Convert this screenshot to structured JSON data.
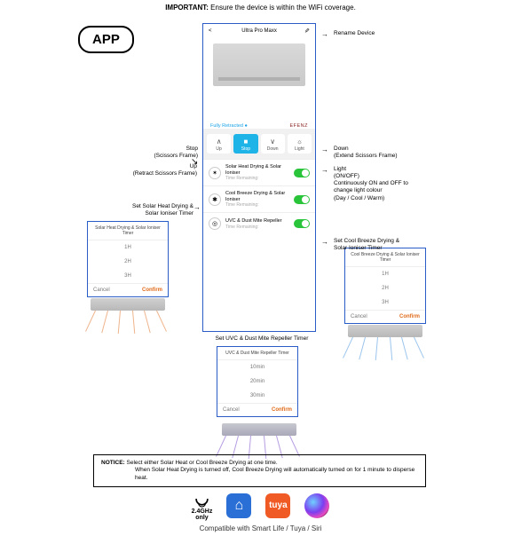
{
  "important": {
    "prefix": "IMPORTANT:",
    "text": " Ensure the device is within the WiFi coverage."
  },
  "app_badge": "APP",
  "phone": {
    "back": "<",
    "title": "Ultra Pro Maxx",
    "edit_icon": "✎",
    "status": {
      "left": "Fully Retracted ●",
      "right": "EFENZ"
    },
    "controls": {
      "up": {
        "icon": "∧",
        "label": "Up"
      },
      "stop": {
        "icon": "■",
        "label": "Stop"
      },
      "down": {
        "icon": "∨",
        "label": "Down"
      },
      "light": {
        "icon": "☼",
        "label": "Light"
      }
    },
    "features": {
      "solar": {
        "icon": "✶",
        "title": "Solar Heat Drying & Solar Ioniser",
        "sub": "Time Remaining:"
      },
      "cool": {
        "icon": "✱",
        "title": "Cool Breeze Drying & Solar Ioniser",
        "sub": "Time Remaining:"
      },
      "uvc": {
        "icon": "◎",
        "title": "UVC & Dust Mite Repeller",
        "sub": "Time Remaining:"
      }
    }
  },
  "labels": {
    "rename": "Rename Device",
    "stop": "Stop\n(Scissors Frame)",
    "up": "Up\n(Retract Scissors Frame)",
    "down": "Down\n(Extend Scissors Frame)",
    "light": "Light\n(ON/OFF)\nContinuously ON and OFF to\nchange light colour\n(Day / Cool / Warm)",
    "solar_timer": "Set Solar Heat Drying &\nSolar Ioniser Timer",
    "cool_timer": "Set Cool Breeze Drying &\nSolar Ioniser Timer",
    "uvc_timer": "Set UVC & Dust Mite Repeller Timer"
  },
  "popups": {
    "solar": {
      "title": "Solar Heat Drying & Solar Ioniser Timer",
      "opts": [
        "1H",
        "2H",
        "3H"
      ],
      "cancel": "Cancel",
      "confirm": "Confirm"
    },
    "cool": {
      "title": "Cool Breeze Drying & Solar Ioniser Timer",
      "opts": [
        "1H",
        "2H",
        "3H"
      ],
      "cancel": "Cancel",
      "confirm": "Confirm"
    },
    "uvc": {
      "title": "UVC & Dust Mite Repeller Timer",
      "opts": [
        "10min",
        "20min",
        "30min"
      ],
      "cancel": "Cancel",
      "confirm": "Confirm"
    }
  },
  "notice": {
    "prefix": "NOTICE:",
    "line1": " Select either Solar Heat or Cool Breeze Drying at one time.",
    "line2": "When Solar Heat Drying is turned off, Cool Breeze Drying will automatically turned on for 1 minute to disperse heat."
  },
  "footer": {
    "wifi1": "2.4GHz",
    "wifi2": "only",
    "tuya": "tuya",
    "compat": "Compatible with Smart Life / Tuya / Siri"
  }
}
